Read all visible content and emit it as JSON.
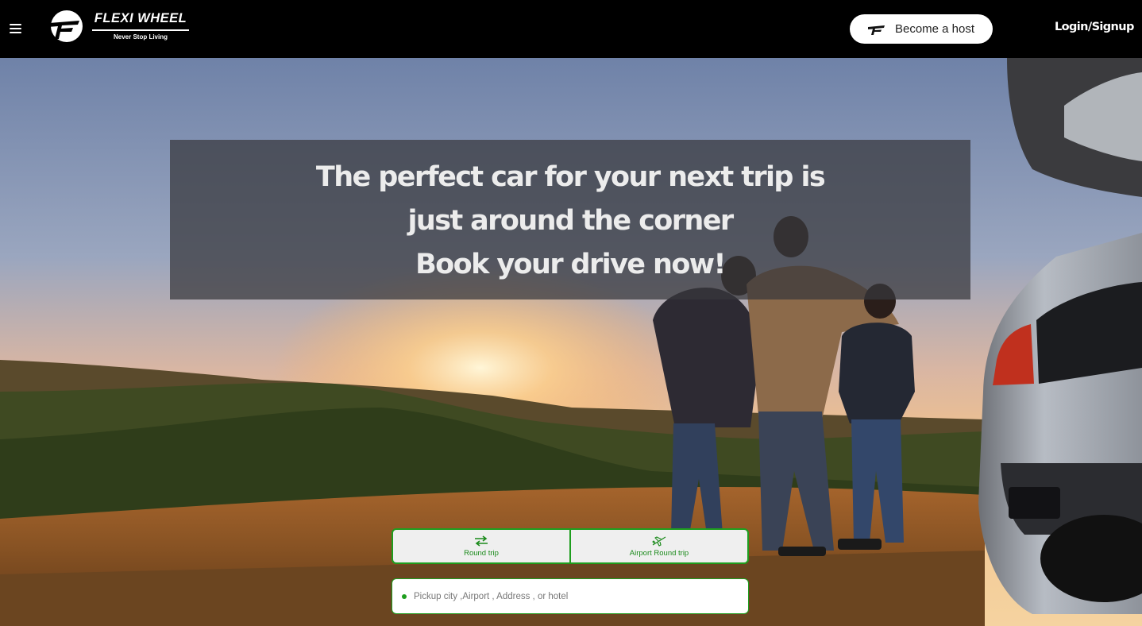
{
  "header": {
    "brand_name": "FLEXI WHEEL",
    "brand_tagline": "Never Stop Living",
    "host_button_label": "Become a host",
    "login_label": "Login/Signup",
    "menu_icon": "hamburger-icon",
    "logo_icon": "flexi-wheel-logo"
  },
  "hero": {
    "headline_lines": [
      "The perfect car for your next trip is",
      "just around the corner",
      "Book your drive now!"
    ],
    "background": "sunset-family-car-photo"
  },
  "booking": {
    "tabs": [
      {
        "label": "Round trip",
        "icon": "swap-arrows-icon"
      },
      {
        "label": "Airport Round trip",
        "icon": "airplane-icon"
      }
    ],
    "pickup_placeholder": "Pickup city ,Airport , Address , or hotel",
    "pickup_value": ""
  },
  "colors": {
    "accent_green": "#1e9e1e",
    "header_bg": "#000000",
    "overlay": "rgba(55,55,60,0.72)"
  }
}
